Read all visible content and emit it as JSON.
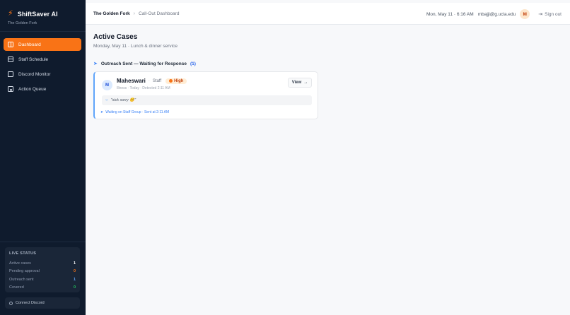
{
  "sidebar": {
    "brand_name": "ShiftSaver AI",
    "brand_icon": "lightning-bolt-icon",
    "org_name": "The Golden Fork",
    "nav": [
      {
        "label": "Dashboard",
        "icon": "dashboard-icon",
        "active": true
      },
      {
        "label": "Staff Schedule",
        "icon": "calendar-icon",
        "active": false
      },
      {
        "label": "Discord Monitor",
        "icon": "chat-icon",
        "active": false
      },
      {
        "label": "Action Queue",
        "icon": "clipboard-icon",
        "active": false
      }
    ],
    "live_status": {
      "title": "LIVE STATUS",
      "rows": [
        {
          "label": "Active cases",
          "value": "1",
          "color": "#ffffff"
        },
        {
          "label": "Pending approval",
          "value": "0",
          "color": "#f97316"
        },
        {
          "label": "Outreach sent",
          "value": "1",
          "color": "#60a5fa"
        },
        {
          "label": "Covered",
          "value": "0",
          "color": "#22c55e"
        }
      ]
    },
    "connect_label": "Connect Discord"
  },
  "topbar": {
    "org": "The Golden Fork",
    "page": "Call-Out Dashboard",
    "datetime": "Mon, May 11 · 6:16 AM",
    "email": "mbajji@g.ucla.edu",
    "avatar_initial": "M",
    "signout_label": "Sign out"
  },
  "main": {
    "title": "Active Cases",
    "subtitle": "Monday, May 11 · Lunch & dinner service",
    "section": {
      "label": "Outreach Sent — Waiting for Response",
      "count": "(1)"
    },
    "card": {
      "initial": "M",
      "name": "Maheswari",
      "role": "Staff",
      "priority": "High",
      "meta": "Illness · Today · Detected 2:11 AM",
      "view_label": "View",
      "quote": "\"sick sorry 🤒\"",
      "waiting": "Waiting on Staff Group · Sent at 2:11 AM"
    }
  },
  "colors": {
    "accent": "#f97316",
    "sidebar_bg": "#0f1b2d",
    "info": "#3b82f6"
  }
}
